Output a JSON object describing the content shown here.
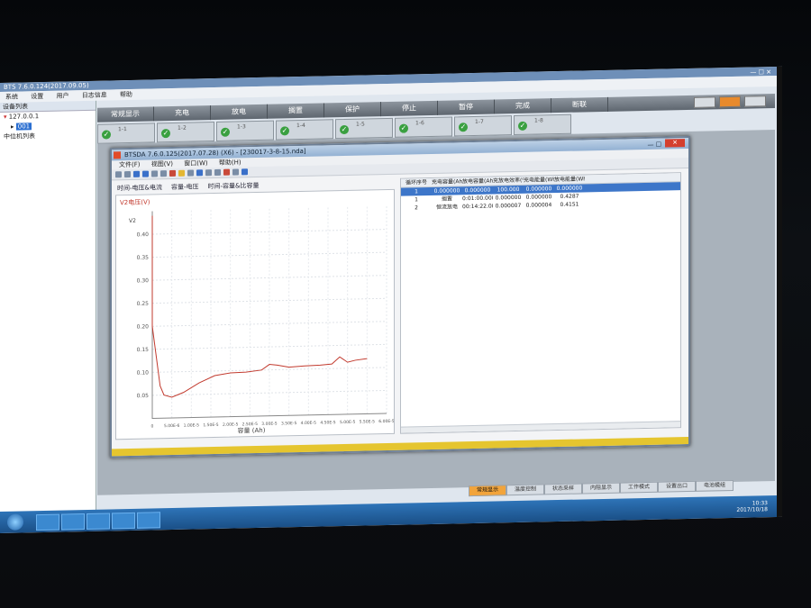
{
  "main_window": {
    "title": "BTS 7.6.0.124(2017.09.05)",
    "menu": [
      "系统",
      "设置",
      "用户",
      "日志信息",
      "帮助"
    ]
  },
  "device_tree": {
    "header": "设备列表",
    "items": [
      "127.0.0.1",
      "001",
      "中位机列表"
    ]
  },
  "toolbar_tabs": [
    "常规显示",
    "充电",
    "放电",
    "搁置",
    "保护",
    "停止",
    "暂停",
    "完成",
    "断联"
  ],
  "channels": [
    "1-1",
    "1-2",
    "1-3",
    "1-4",
    "1-5",
    "1-6",
    "1-7",
    "1-8"
  ],
  "bottom_tabs": [
    "常规显示",
    "温度控制",
    "状态采样",
    "内阻显示",
    "工作模式",
    "设置出口",
    "电池模组"
  ],
  "data_window": {
    "title": "BTSDA 7.6.0.125(2017.07.28) (X6) - [230017-3-8-15.nda]",
    "menu": [
      "文件(F)",
      "视图(V)",
      "窗口(W)",
      "帮助(H)"
    ],
    "chart_tabs": [
      "时间-电压&电流",
      "容量-电压",
      "时间-容量&比容量"
    ],
    "table_headers": [
      "循环序号",
      "充电容量(Ah)",
      "放电容量(Ah)",
      "充放电效率(%)",
      "充电能量(Wh)",
      "放电能量(Wh)"
    ],
    "table_rows": [
      [
        "1",
        "0.000000",
        "0.000000",
        "100.000",
        "0.000000",
        "0.000000"
      ],
      [
        "1",
        "搁置",
        "0:01:00.000",
        "0.000000",
        "0.000000",
        "0.4287"
      ],
      [
        "2",
        "恒流放电",
        "00:14:22.000",
        "0.000007",
        "0.000004",
        "0.4151"
      ]
    ]
  },
  "chart_data": {
    "type": "line",
    "title": "",
    "ylabel": "V2电压(V)",
    "y_axis_unit": "V2",
    "xlabel": "容量 (Ah)",
    "ylim": [
      0.0,
      0.45
    ],
    "yticks": [
      "0.40",
      "0.35",
      "0.30",
      "0.25",
      "0.20",
      "0.15",
      "0.10",
      "0.05"
    ],
    "xticks": [
      "0",
      "5.00E-6",
      "1.00E-5",
      "1.50E-5",
      "2.00E-5",
      "2.50E-5",
      "3.00E-5",
      "3.50E-5",
      "4.00E-5",
      "4.50E-5",
      "5.00E-5",
      "5.50E-5",
      "6.00E-5"
    ],
    "series": [
      {
        "color": "#c23a2e",
        "x": [
          0.0,
          0.0,
          2e-06,
          3e-06,
          5e-06,
          8e-06,
          1.2e-05,
          1.6e-05,
          2e-05,
          2.4e-05,
          2.8e-05,
          3e-05,
          3.2e-05,
          3.5e-05,
          3.9e-05,
          4.3e-05,
          4.6e-05,
          4.8e-05,
          5e-05,
          5.2e-05,
          5.5e-05
        ],
        "y": [
          0.44,
          0.2,
          0.07,
          0.05,
          0.045,
          0.055,
          0.075,
          0.09,
          0.095,
          0.096,
          0.1,
          0.112,
          0.11,
          0.105,
          0.107,
          0.108,
          0.11,
          0.125,
          0.113,
          0.117,
          0.12
        ]
      }
    ],
    "grid": true
  },
  "taskbar": {
    "time": "10:33",
    "date": "2017/10/18"
  },
  "colors": {
    "accent_orange": "#f2a43b",
    "status_yellow": "#e5c52f",
    "line_red": "#c23a2e",
    "ok_green": "#3aa040"
  }
}
